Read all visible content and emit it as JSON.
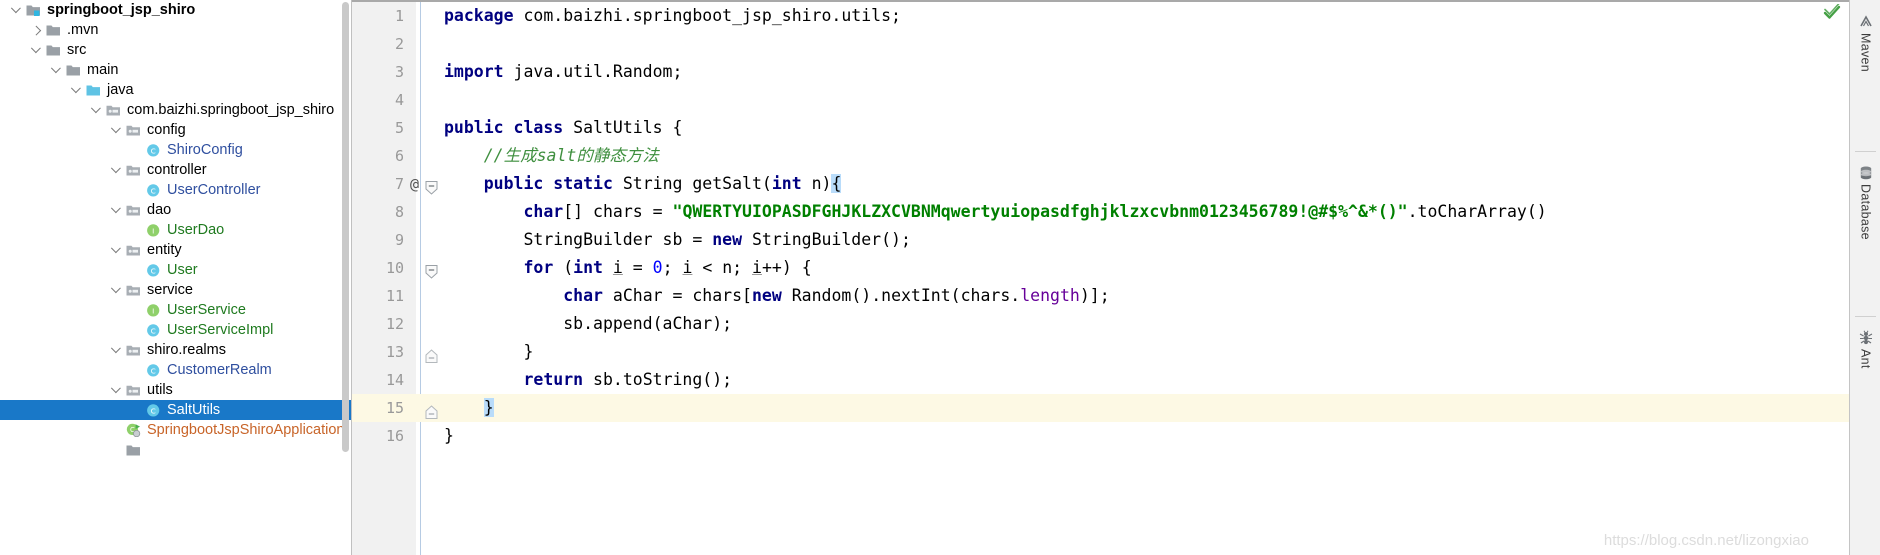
{
  "project_tree": {
    "scrollbar": "vertical-scrollbar",
    "items": [
      {
        "label": "springboot_jsp_shiro",
        "depth": 0,
        "arrow": "expanded",
        "icon": "module-folder-icon",
        "style": "bold"
      },
      {
        "label": ".mvn",
        "depth": 1,
        "arrow": "collapsed",
        "icon": "folder-icon",
        "style": "plain"
      },
      {
        "label": "src",
        "depth": 1,
        "arrow": "expanded",
        "icon": "folder-icon",
        "style": "plain"
      },
      {
        "label": "main",
        "depth": 2,
        "arrow": "expanded",
        "icon": "folder-icon",
        "style": "plain"
      },
      {
        "label": "java",
        "depth": 3,
        "arrow": "expanded",
        "icon": "source-folder-icon",
        "style": "plain"
      },
      {
        "label": "com.baizhi.springboot_jsp_shiro",
        "depth": 4,
        "arrow": "expanded",
        "icon": "package-icon",
        "style": "plain"
      },
      {
        "label": "config",
        "depth": 5,
        "arrow": "expanded",
        "icon": "package-icon",
        "style": "plain"
      },
      {
        "label": "ShiroConfig",
        "depth": 6,
        "arrow": "none",
        "icon": "java-class-icon",
        "style": "class"
      },
      {
        "label": "controller",
        "depth": 5,
        "arrow": "expanded",
        "icon": "package-icon",
        "style": "plain"
      },
      {
        "label": "UserController",
        "depth": 6,
        "arrow": "none",
        "icon": "java-class-icon",
        "style": "class"
      },
      {
        "label": "dao",
        "depth": 5,
        "arrow": "expanded",
        "icon": "package-icon",
        "style": "plain"
      },
      {
        "label": "UserDao",
        "depth": 6,
        "arrow": "none",
        "icon": "java-interface-icon",
        "style": "green"
      },
      {
        "label": "entity",
        "depth": 5,
        "arrow": "expanded",
        "icon": "package-icon",
        "style": "plain"
      },
      {
        "label": "User",
        "depth": 6,
        "arrow": "none",
        "icon": "java-class-icon",
        "style": "green"
      },
      {
        "label": "service",
        "depth": 5,
        "arrow": "expanded",
        "icon": "package-icon",
        "style": "plain"
      },
      {
        "label": "UserService",
        "depth": 6,
        "arrow": "none",
        "icon": "java-interface-icon",
        "style": "green"
      },
      {
        "label": "UserServiceImpl",
        "depth": 6,
        "arrow": "none",
        "icon": "java-class-icon",
        "style": "green"
      },
      {
        "label": "shiro.realms",
        "depth": 5,
        "arrow": "expanded",
        "icon": "package-icon",
        "style": "plain"
      },
      {
        "label": "CustomerRealm",
        "depth": 6,
        "arrow": "none",
        "icon": "java-class-icon",
        "style": "class"
      },
      {
        "label": "utils",
        "depth": 5,
        "arrow": "expanded",
        "icon": "package-icon",
        "style": "plain"
      },
      {
        "label": "SaltUtils",
        "depth": 6,
        "arrow": "none",
        "icon": "java-class-icon",
        "style": "class",
        "selected": true
      },
      {
        "label": "SpringbootJspShiroApplication",
        "depth": 5,
        "arrow": "none",
        "icon": "runnable-class-icon",
        "style": "orange"
      },
      {
        "label": "",
        "depth": 5,
        "arrow": "none",
        "icon": "folder-icon",
        "style": "plain"
      }
    ]
  },
  "editor": {
    "status_icon": "inspection-ok-checkmark-icon",
    "watermark": "https://blog.csdn.net/lizongxiao",
    "lines": [
      {
        "n": "1",
        "html": "<span class=\"kw\">package</span> com.baizhi.springboot_jsp_shiro.utils;"
      },
      {
        "n": "2",
        "html": ""
      },
      {
        "n": "3",
        "html": "<span class=\"kw\">import</span> java.util.Random;"
      },
      {
        "n": "4",
        "html": ""
      },
      {
        "n": "5",
        "html": "<span class=\"kw\">public</span> <span class=\"kw\">class</span> SaltUtils {"
      },
      {
        "n": "6",
        "html": "    <span class=\"cmt\">//生成salt的静态方法</span>"
      },
      {
        "n": "7",
        "html": "    <span class=\"kw\">public</span> <span class=\"kw\">static</span> String getSalt(<span class=\"kw\">int</span> n)<span class=\"brace-hl\">{</span>",
        "marker": "@",
        "fold": "collapse"
      },
      {
        "n": "8",
        "html": "        <span class=\"kw\">char</span>[] chars = <span class=\"str\">\"QWERTYUIOPASDFGHJKLZXCVBNMqwertyuiopasdfghjklzxcvbnm0123456789!@#$%^&amp;*()\"</span>.toCharArray()"
      },
      {
        "n": "9",
        "html": "        StringBuilder sb = <span class=\"kw\">new</span> StringBuilder();"
      },
      {
        "n": "10",
        "html": "        <span class=\"kw\">for</span> (<span class=\"kw\">int</span> <span class=\"und\">i</span> = <span class=\"num\">0</span>; <span class=\"und\">i</span> &lt; n; <span class=\"und\">i</span>++) {",
        "fold": "collapse"
      },
      {
        "n": "11",
        "html": "            <span class=\"kw\">char</span> aChar = chars[<span class=\"kw\">new</span> Random().nextInt(chars.<span class=\"fld\">length</span>)];"
      },
      {
        "n": "12",
        "html": "            sb.append(aChar);"
      },
      {
        "n": "13",
        "html": "        }",
        "fold": "end"
      },
      {
        "n": "14",
        "html": "        <span class=\"kw\">return</span> sb.toString();"
      },
      {
        "n": "15",
        "html": "    <span class=\"brace-hl\">}</span>",
        "fold": "end",
        "caret": true
      },
      {
        "n": "16",
        "html": "}"
      }
    ]
  },
  "right_toolbar": {
    "tabs": [
      {
        "label": "Maven",
        "icon": "maven-icon"
      },
      {
        "label": "Database",
        "icon": "database-icon"
      },
      {
        "label": "Ant",
        "icon": "ant-icon"
      }
    ]
  }
}
